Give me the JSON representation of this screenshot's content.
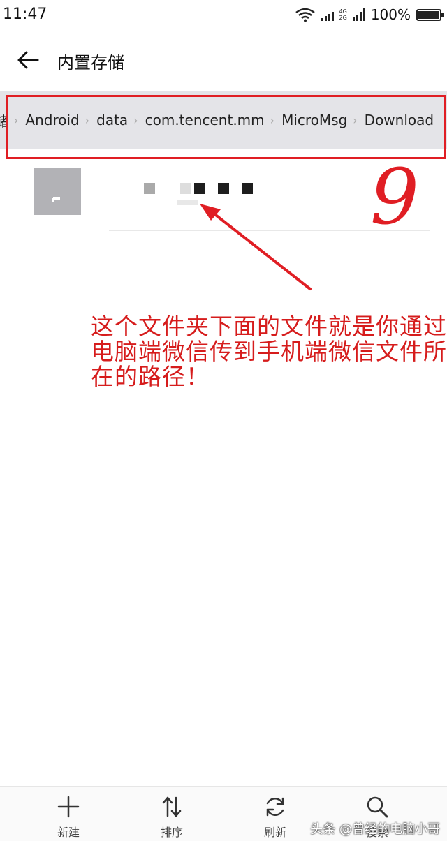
{
  "status_bar": {
    "time": "11:47",
    "network_top": "4G",
    "network_bottom": "2G",
    "battery_text": "100%"
  },
  "header": {
    "title": "内置存储"
  },
  "breadcrumb": {
    "items": [
      "储",
      "Android",
      "data",
      "com.tencent.mm",
      "MicroMsg",
      "Download"
    ]
  },
  "annotation": {
    "number": "9",
    "text": "这个文件夹下面的文件就是你通过电脑端微信传到手机端微信文件所在的路径！"
  },
  "toolbar": {
    "new_label": "新建",
    "sort_label": "排序",
    "refresh_label": "刷新",
    "search_label": "搜索"
  },
  "watermark": "头条 @曾经的电脑小哥",
  "colors": {
    "annotation_red": "#e01e24",
    "breadcrumb_bg": "#e4e4e8",
    "thumb_gray": "#b2b2b6"
  }
}
